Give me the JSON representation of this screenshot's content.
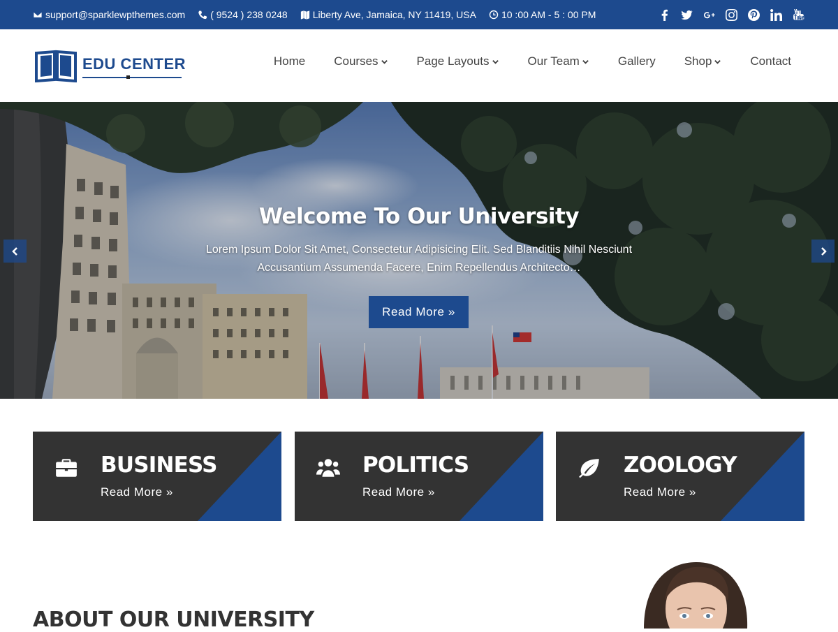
{
  "topbar": {
    "email": "support@sparklewpthemes.com",
    "phone": "( 9524 ) 238 0248",
    "address": "Liberty Ave, Jamaica, NY 11419, USA",
    "hours": "10 :00 AM - 5 : 00 PM",
    "social": [
      "facebook-icon",
      "twitter-icon",
      "google-plus-icon",
      "instagram-icon",
      "pinterest-icon",
      "linkedin-icon",
      "youtube-icon"
    ],
    "bg_color": "#1d4a8e"
  },
  "logo": {
    "text": "EDU CENTER"
  },
  "nav": {
    "items": [
      {
        "label": "Home"
      },
      {
        "label": "Courses"
      },
      {
        "label": "Page Layouts"
      },
      {
        "label": "Our Team"
      },
      {
        "label": "Gallery"
      },
      {
        "label": "Shop"
      },
      {
        "label": "Contact"
      }
    ]
  },
  "hero": {
    "title": "Welcome To Our University",
    "description": "Lorem Ipsum Dolor Sit Amet, Consectetur Adipisicing Elit. Sed Blanditiis Nihil Nesciunt Accusantium Assumenda Facere, Enim Repellendus Architecto…",
    "button": "Read More »"
  },
  "cards": [
    {
      "title": "BUSINESS",
      "link": "Read More »",
      "icon": "briefcase-icon"
    },
    {
      "title": "POLITICS",
      "link": "Read More »",
      "icon": "users-icon"
    },
    {
      "title": "ZOOLOGY",
      "link": "Read More »",
      "icon": "leaf-icon"
    }
  ],
  "about": {
    "title": "ABOUT OUR UNIVERSITY"
  },
  "colors": {
    "primary": "#1d4a8e",
    "card_bg": "#333333"
  }
}
